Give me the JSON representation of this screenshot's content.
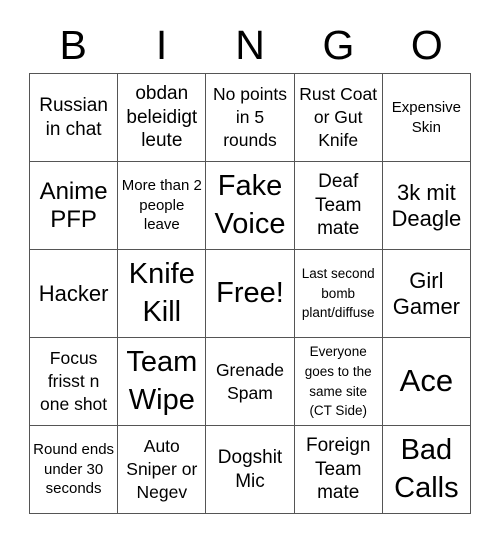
{
  "title_letters": [
    "B",
    "I",
    "N",
    "G",
    "O"
  ],
  "cells": [
    "Russian in chat",
    "obdan beleidigt leute",
    "No points in 5 rounds",
    "Rust Coat or Gut Knife",
    "Expensive Skin",
    "Anime PFP",
    "More than 2 people leave",
    "Fake Voice",
    "Deaf Team mate",
    "3k mit Deagle",
    "Hacker",
    "Knife Kill",
    "Free!",
    "Last second bomb plant/diffuse",
    "Girl Gamer",
    "Focus frisst n one shot",
    "Team Wipe",
    "Grenade Spam",
    "Everyone goes to the same site (CT Side)",
    "Ace",
    "Round ends under 30 seconds",
    "Auto Sniper or Negev",
    "Dogshit Mic",
    "Foreign Team mate",
    "Bad Calls"
  ],
  "free_space_index": 12,
  "colors": {
    "border": "#555555",
    "text": "#000000",
    "background": "#ffffff"
  }
}
